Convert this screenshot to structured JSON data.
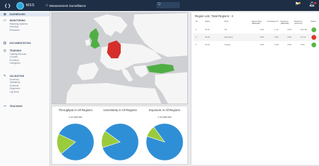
{
  "header": {
    "app_name": "MSS",
    "page_title": "Measurement Surveillance",
    "search_text": "Q"
  },
  "sidebar": {
    "dashboard": "DASHBOARD",
    "monitoring": "MONITORING",
    "monitoring_items": [
      "Watching Systems",
      "Inventory",
      "Emissions"
    ],
    "documentation": "DOCUMENTATION",
    "training": "TRAINING",
    "training_items": [
      "Training Records",
      "Courses",
      "Providers",
      "Categories"
    ],
    "validation": "VALIDATION",
    "validation_items": [
      "Summary",
      "Validations",
      "Schedule",
      "Equipment",
      "Log Book"
    ],
    "tracking": "TRACKING"
  },
  "charts": [
    {
      "title": "Throughput in All Regions",
      "subtitle": "4.41 MMCMD",
      "slices": [
        {
          "label": "Region A",
          "value": 82
        },
        {
          "label": "Region B",
          "value": 18
        }
      ]
    },
    {
      "title": "Uncertainty in All Regions",
      "subtitle": "",
      "slices": [
        {
          "label": "Region A",
          "value": 85
        },
        {
          "label": "Region B",
          "value": 15
        }
      ]
    },
    {
      "title": "Exposure in All Regions",
      "subtitle": "0.00 MMCMD",
      "slices": [
        {
          "label": "Region A",
          "value": 90
        },
        {
          "label": "Region B",
          "value": 10
        }
      ]
    }
  ],
  "chart_data": [
    {
      "type": "pie",
      "title": "Throughput in All Regions",
      "categories": [
        "A",
        "B"
      ],
      "values": [
        82,
        18
      ]
    },
    {
      "type": "pie",
      "title": "Uncertainty in All Regions",
      "categories": [
        "A",
        "B"
      ],
      "values": [
        85,
        15
      ]
    },
    {
      "type": "pie",
      "title": "Exposure in All Regions",
      "categories": [
        "A",
        "B"
      ],
      "values": [
        90,
        10
      ]
    }
  ],
  "table": {
    "title": "Region List, Total Regions : 3",
    "columns": [
      "ID",
      "Name",
      "Desc",
      "Report Flow (MMCMD)",
      "Uncertainty %",
      "Exposure (MMCMD)",
      "Exposure (e/hr/unit)",
      "Status"
    ],
    "rows": [
      {
        "id": "1",
        "name": "R-01",
        "desc": "UK",
        "flow": "0.00",
        "uncert": "1.12",
        "exp": "0.00",
        "exp2": "144.02",
        "status": "green"
      },
      {
        "id": "2",
        "name": "R-02",
        "desc": "Germany",
        "flow": "0.00",
        "uncert": "0.32",
        "exp": "0.00",
        "exp2": "17.14",
        "status": "red"
      },
      {
        "id": "3",
        "name": "R-03",
        "desc": "Turkey",
        "flow": "0.00",
        "uncert": "0.18",
        "exp": "0.00",
        "exp2": "0.00",
        "status": "green"
      }
    ]
  },
  "colors": {
    "topbar": "#1e2f45",
    "pie_main": "#2f8fd6",
    "pie_secondary": "#9acb3c",
    "status_green": "#59b64a",
    "status_red": "#d83a2e",
    "map_uk": "#4fae44",
    "map_germany": "#d42f2a",
    "map_turkey": "#4fae44"
  }
}
